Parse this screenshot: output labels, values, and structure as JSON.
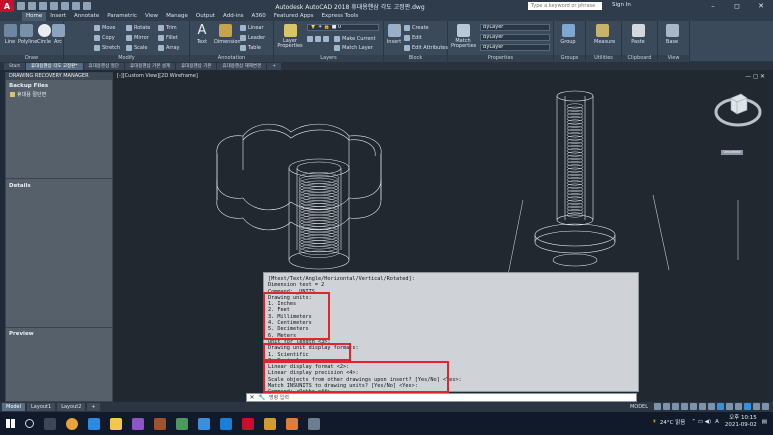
{
  "titlebar": {
    "title": "Autodesk AutoCAD 2018    휴대용핸삼 각도 고정판.dwg",
    "search_placeholder": "Type a keyword or phrase",
    "signin": "Sign In",
    "logo": "A"
  },
  "ribbon_tabs": [
    "Home",
    "Insert",
    "Annotate",
    "Parametric",
    "View",
    "Manage",
    "Output",
    "Add-ins",
    "A360",
    "Featured Apps",
    "Express Tools"
  ],
  "ribbon": {
    "draw": {
      "label": "Draw",
      "line": "Line",
      "polyline": "Polyline",
      "circle": "Circle",
      "arc": "Arc"
    },
    "modify": {
      "label": "Modify",
      "move": "Move",
      "rotate": "Rotate",
      "trim": "Trim",
      "copy": "Copy",
      "mirror": "Mirror",
      "fillet": "Fillet",
      "stretch": "Stretch",
      "scale": "Scale",
      "array": "Array"
    },
    "annotation": {
      "label": "Annotation",
      "text": "Text",
      "dimension": "Dimension",
      "linear": "Linear",
      "leader": "Leader",
      "table": "Table"
    },
    "layers": {
      "label": "Layers",
      "layer_properties": "Layer Properties",
      "make_current": "Make Current",
      "match_layer": "Match Layer"
    },
    "block": {
      "label": "Block",
      "insert": "Insert",
      "create": "Create",
      "edit": "Edit",
      "edit_attributes": "Edit Attributes"
    },
    "properties": {
      "label": "Properties",
      "match": "Match Properties",
      "bylayer1": "ByLayer",
      "bylayer2": "ByLayer",
      "bylayer3": "ByLayer"
    },
    "groups": {
      "label": "Groups",
      "group": "Group"
    },
    "utilities": {
      "label": "Utilities",
      "measure": "Measure"
    },
    "clipboard": {
      "label": "Clipboard",
      "paste": "Paste"
    },
    "view": {
      "label": "View",
      "base": "Base"
    }
  },
  "doc_tabs": [
    "Start",
    "휴대용핸삼 각도 고정판*",
    "휴대용핸삼 절단",
    "휴대용핸삼 기본 설계",
    "휴대용핸삼 기본",
    "휴대용핸삼 해제변경"
  ],
  "palette": {
    "title": "DRAWING RECOVERY MANAGER",
    "backup_files": "Backup Files",
    "backup_item": "휴대용 절단면",
    "details": "Details",
    "preview": "Preview"
  },
  "viewport": {
    "label": "[-][Custom View][2D Wireframe]",
    "controls": "— ◻ ✕",
    "viewcube_label": "Unnamed"
  },
  "command": {
    "lines": [
      "[Mtext/Text/Angle/Horizontal/Vertical/Rotated]:",
      "Dimension text = 2",
      "Command: _UNITS",
      "Drawing units:",
      "  1. Inches",
      "  2. Feet",
      "  3. Millimeters",
      "  4. Centimeters",
      "  5. Decimeters",
      "  6. Meters",
      "Unit for length <3>:",
      "Drawing unit display formats:",
      "  1. Scientific",
      "  2. Decimal",
      "Linear display format <2>:",
      "Linear display precision <4>:",
      "Scale objects from other drawings upon insert? [Yes/No] <Yes>:",
      "Match INSUNITS to drawing units? [Yes/No] <Yes>:",
      "Command: <Ortho off>"
    ],
    "input_placeholder": "명령 입력"
  },
  "status": {
    "layouts": [
      "Model",
      "Layout1",
      "Layout2"
    ],
    "add_layout": "+",
    "model_label": "MODEL"
  },
  "taskbar": {
    "weather": "24°C 맑음",
    "lang": "A",
    "time": "오후 10:15",
    "date": "2021-09-02"
  }
}
